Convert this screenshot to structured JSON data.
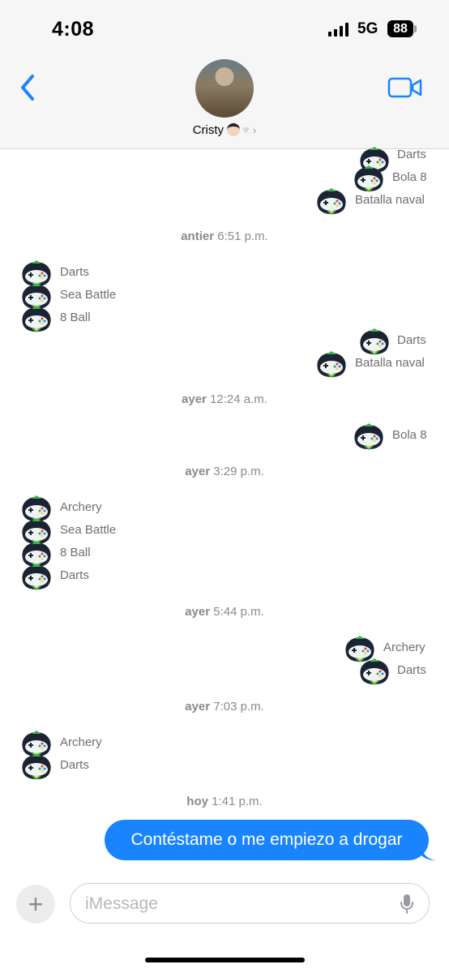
{
  "status_bar": {
    "time": "4:08",
    "network": "5G",
    "battery": "88"
  },
  "header": {
    "contact_name": "Cristy",
    "back_icon": "chevron-left-icon",
    "video_icon": "video-camera-icon"
  },
  "colors": {
    "accent": "#1a84ff",
    "label_gray": "#6e6e73",
    "bg": "#f6f6f6"
  },
  "messages": {
    "g1": [
      "Darts",
      "Bola 8",
      "Batalla naval"
    ],
    "t1": {
      "day": "antier",
      "time": "6:51 p.m."
    },
    "g2": [
      "Darts",
      "Sea Battle",
      "8 Ball"
    ],
    "g3": [
      "Darts",
      "Batalla naval"
    ],
    "t2": {
      "day": "ayer",
      "time": "12:24 a.m."
    },
    "g4": [
      "Bola 8"
    ],
    "t3": {
      "day": "ayer",
      "time": "3:29 p.m."
    },
    "g5": [
      "Archery",
      "Sea Battle",
      "8 Ball",
      "Darts"
    ],
    "t4": {
      "day": "ayer",
      "time": "5:44 p.m."
    },
    "g6": [
      "Archery",
      "Darts"
    ],
    "t5": {
      "day": "ayer",
      "time": "7:03 p.m."
    },
    "g7": [
      "Archery",
      "Darts"
    ],
    "t6": {
      "day": "hoy",
      "time": "1:41 p.m."
    },
    "outgoing": "Contéstame o me empiezo a drogar"
  },
  "composer": {
    "placeholder": "iMessage",
    "plus_icon": "plus-icon",
    "mic_icon": "microphone-icon"
  }
}
